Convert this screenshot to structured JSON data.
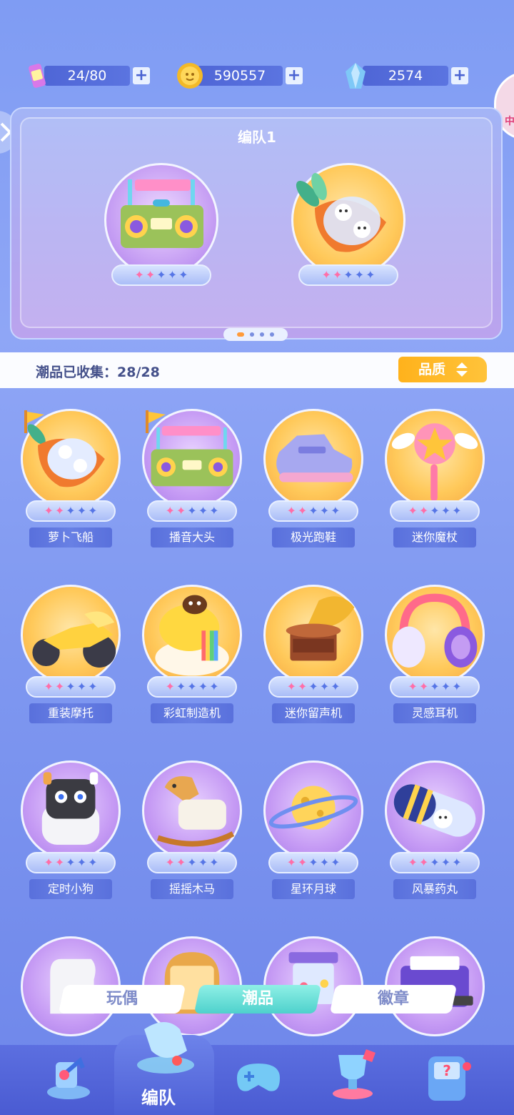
{
  "currencies": [
    {
      "icon": "energy-can-icon",
      "value": "24/80"
    },
    {
      "icon": "gold-coin-icon",
      "value": "590557"
    },
    {
      "icon": "blue-crystal-icon",
      "value": "2574"
    }
  ],
  "side_badge": "中",
  "team": {
    "title": "编队1",
    "slots": [
      {
        "icon": "boombox-icon",
        "stars_filled": 2,
        "stars_total": 5
      },
      {
        "icon": "carrot-rocket-icon",
        "stars_filled": 2,
        "stars_total": 5
      }
    ],
    "page_count": 4,
    "active_page": 1
  },
  "collection": {
    "label": "潮品已收集：",
    "count": "28/28",
    "sort_label": "品质"
  },
  "items": [
    {
      "name": "萝卜飞船",
      "icon": "carrot-rocket-icon",
      "style": "gold",
      "flag": true,
      "stars": 2
    },
    {
      "name": "播音大头",
      "icon": "boombox-icon",
      "style": "purple",
      "flag": true,
      "stars": 2
    },
    {
      "name": "极光跑鞋",
      "icon": "sneaker-icon",
      "style": "gold",
      "flag": false,
      "stars": 2
    },
    {
      "name": "迷你魔杖",
      "icon": "star-wand-icon",
      "style": "gold",
      "flag": false,
      "stars": 2
    },
    {
      "name": "重装摩托",
      "icon": "motorcycle-icon",
      "style": "gold",
      "flag": false,
      "stars": 2
    },
    {
      "name": "彩虹制造机",
      "icon": "rainbow-machine-icon",
      "style": "gold",
      "flag": false,
      "stars": 1
    },
    {
      "name": "迷你留声机",
      "icon": "gramophone-icon",
      "style": "gold",
      "flag": false,
      "stars": 2
    },
    {
      "name": "灵感耳机",
      "icon": "headphones-icon",
      "style": "gold",
      "flag": false,
      "stars": 2
    },
    {
      "name": "定时小狗",
      "icon": "robot-dog-icon",
      "style": "purple",
      "flag": false,
      "stars": 2
    },
    {
      "name": "摇摇木马",
      "icon": "rocking-horse-icon",
      "style": "purple",
      "flag": false,
      "stars": 2
    },
    {
      "name": "星环月球",
      "icon": "ringed-moon-icon",
      "style": "purple",
      "flag": false,
      "stars": 2
    },
    {
      "name": "风暴药丸",
      "icon": "storm-pill-icon",
      "style": "purple",
      "flag": false,
      "stars": 2
    },
    {
      "name": "",
      "icon": "glove-icon",
      "style": "purple",
      "flag": false,
      "stars": 0
    },
    {
      "name": "",
      "icon": "toast-icon",
      "style": "purple",
      "flag": false,
      "stars": 0
    },
    {
      "name": "",
      "icon": "gumball-machine-icon",
      "style": "purple",
      "flag": false,
      "stars": 0
    },
    {
      "name": "",
      "icon": "printer-icon",
      "style": "purple",
      "flag": false,
      "stars": 0
    }
  ],
  "tabs": [
    {
      "label": "玩偶",
      "active": false
    },
    {
      "label": "潮品",
      "active": true
    },
    {
      "label": "徽章",
      "active": false
    }
  ],
  "nav": {
    "active_label": "编队",
    "icons": [
      "scroll-arrow-icon",
      "whistle-icon",
      "gamepad-icon",
      "trophy-icon",
      "mystery-box-icon"
    ]
  },
  "colors": {
    "star_filled": "#ff6ea8",
    "star_empty": "#5675e6",
    "quality_button": "#ffb21c",
    "active_tab": "#4ed1cc"
  }
}
